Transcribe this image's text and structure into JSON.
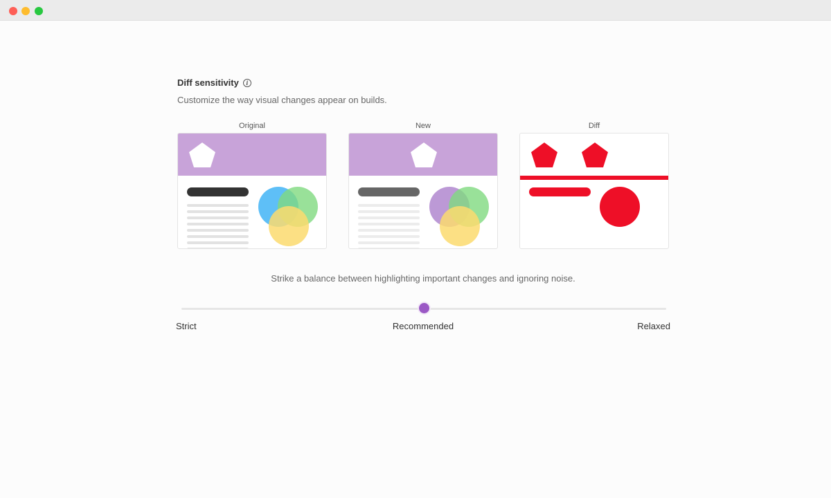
{
  "window": {
    "traffic_lights": [
      "close",
      "minimize",
      "maximize"
    ],
    "colors": {
      "close": "#fe5f57",
      "minimize": "#febc2e",
      "maximize": "#28c840"
    }
  },
  "section": {
    "title": "Diff sensitivity",
    "info_icon": "info-icon",
    "description": "Customize the way visual changes appear on builds."
  },
  "panels": [
    {
      "label": "Original"
    },
    {
      "label": "New"
    },
    {
      "label": "Diff"
    }
  ],
  "colors": {
    "header_purple": "#c8a3d9",
    "diff_red": "#ee0f27",
    "accent": "#9b59c5",
    "blue_circle": "#4cb8f6",
    "green_circle": "#7fd97f",
    "yellow_circle": "#fbdb6f",
    "purple_circle": "#b58ed1"
  },
  "balance_text": "Strike a balance between highlighting important changes and ignoring noise.",
  "slider": {
    "value": 0.5,
    "labels": {
      "min": "Strict",
      "mid": "Recommended",
      "max": "Relaxed"
    }
  }
}
